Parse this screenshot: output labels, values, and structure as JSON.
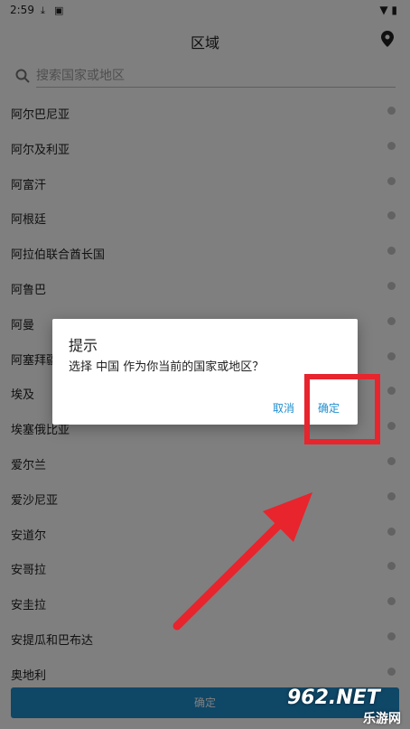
{
  "status_bar": {
    "time": "2:59",
    "icons": [
      "download-icon",
      "image-icon"
    ],
    "right_icons": [
      "wifi-icon",
      "battery-icon"
    ]
  },
  "app_bar": {
    "title": "区域",
    "location_icon": "location-pin-icon"
  },
  "search": {
    "placeholder": "搜索国家或地区",
    "value": ""
  },
  "countries": [
    {
      "name": "阿尔巴尼亚"
    },
    {
      "name": "阿尔及利亚"
    },
    {
      "name": "阿富汗"
    },
    {
      "name": "阿根廷"
    },
    {
      "name": "阿拉伯联合酋长国"
    },
    {
      "name": "阿鲁巴"
    },
    {
      "name": "阿曼"
    },
    {
      "name": "阿塞拜疆"
    },
    {
      "name": "埃及"
    },
    {
      "name": "埃塞俄比亚"
    },
    {
      "name": "爱尔兰"
    },
    {
      "name": "爱沙尼亚"
    },
    {
      "name": "安道尔"
    },
    {
      "name": "安哥拉"
    },
    {
      "name": "安圭拉"
    },
    {
      "name": "安提瓜和巴布达"
    },
    {
      "name": "奥地利"
    }
  ],
  "bottom_button": {
    "label": "确定"
  },
  "dialog": {
    "title": "提示",
    "message": "选择 中国 作为你当前的国家或地区？",
    "cancel_label": "取消",
    "confirm_label": "确定"
  },
  "annotation": {
    "color": "#e8242d"
  },
  "watermark": {
    "line1": "962.NET",
    "line2": "乐游网"
  },
  "colors": {
    "accent": "#1f8fce",
    "overlay": "rgba(0,0,0,0.5)"
  }
}
